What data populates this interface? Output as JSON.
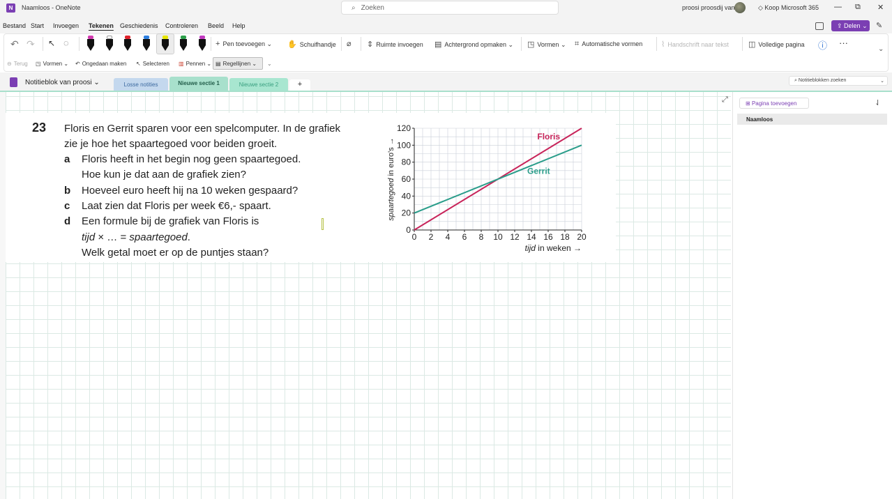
{
  "window": {
    "title": "Naamloos - OneNote",
    "app_icon": "N",
    "search_placeholder": "Zoeken",
    "user": "proosi proosdij van",
    "koop": "Koop Microsoft 365",
    "controls": [
      "—",
      "⧉",
      "✕"
    ]
  },
  "menu": {
    "items": [
      "Bestand",
      "Start",
      "Invoegen",
      "Tekenen",
      "Geschiedenis",
      "Controleren",
      "Beeld",
      "Help"
    ],
    "active": "Tekenen",
    "share_label": "Delen"
  },
  "ribbon": {
    "pen_colors": [
      "#d23bb0",
      "#ffffff",
      "#e0232c",
      "#2d7fe0",
      "#e7e600",
      "#2ca04a",
      "#c13bc0"
    ],
    "add_pen": "Pen toevoegen",
    "schuifhandje": "Schuifhandje",
    "ruimte": "Ruimte invoegen",
    "achtergrond": "Achtergrond opmaken",
    "vormen": "Vormen",
    "auto_vormen": "Automatische vormen",
    "handschrift": "Handschrift naar tekst",
    "volledige": "Volledige pagina",
    "more": "···"
  },
  "ribbon2": {
    "terug": "Terug",
    "vormen": "Vormen",
    "ongedaan": "Ongedaan maken",
    "selecteren": "Selecteren",
    "pennen": "Pennen",
    "regellijnen": "Regellijnen"
  },
  "notebook": {
    "name": "Notitieblok van proosi",
    "sections": [
      {
        "label": "Losse notities",
        "color": "#c4d8ee",
        "text": "#3d6aa0"
      },
      {
        "label": "Nieuwe sectie 1",
        "color": "#a8e0cc",
        "text": "#225d4a"
      },
      {
        "label": "Nieuwe sectie 2",
        "color": "#a8e6d0",
        "text": "#3aa080"
      }
    ],
    "add_section": "+",
    "search_placeholder": "Notitieblokken zoeken"
  },
  "pages": {
    "add_page": "Pagina toevoegen",
    "items": [
      "Naamloos"
    ]
  },
  "exercise": {
    "number": "23",
    "intro_1": "Floris en Gerrit sparen voor een spelcomputer. In de grafiek",
    "intro_2": "zie je hoe het spaartegoed voor beiden groeit.",
    "a_label": "a",
    "a_1": "Floris heeft in het begin nog geen spaartegoed.",
    "a_2": "Hoe kun je dat aan de grafiek zien?",
    "b_label": "b",
    "b_1": "Hoeveel euro heeft hij na 10 weken gespaard?",
    "c_label": "c",
    "c_1": "Laat zien dat Floris per week €6,- spaart.",
    "d_label": "d",
    "d_1": "Een formule bij de grafiek van Floris is",
    "d_2_italic": "tijd",
    "d_2_mid": " × … = ",
    "d_2_italic2": "spaartegoed",
    "d_2_end": ".",
    "d_3": "Welk getal moet er op de puntjes staan?"
  },
  "chart_data": {
    "type": "line",
    "xlabel_italic": "tijd",
    "xlabel_rest": " in weken →",
    "ylabel_italic": "spaartegoed",
    "ylabel_rest": " in euro's →",
    "xlim": [
      0,
      20
    ],
    "ylim": [
      0,
      120
    ],
    "x_ticks": [
      0,
      2,
      4,
      6,
      8,
      10,
      12,
      14,
      16,
      18,
      20
    ],
    "y_ticks": [
      0,
      20,
      40,
      60,
      80,
      100,
      120
    ],
    "grid": true,
    "series": [
      {
        "name": "Floris",
        "color": "#c8245a",
        "x": [
          0,
          20
        ],
        "y": [
          0,
          120
        ]
      },
      {
        "name": "Gerrit",
        "color": "#2a9d8a",
        "x": [
          0,
          20
        ],
        "y": [
          20,
          100
        ]
      }
    ]
  }
}
